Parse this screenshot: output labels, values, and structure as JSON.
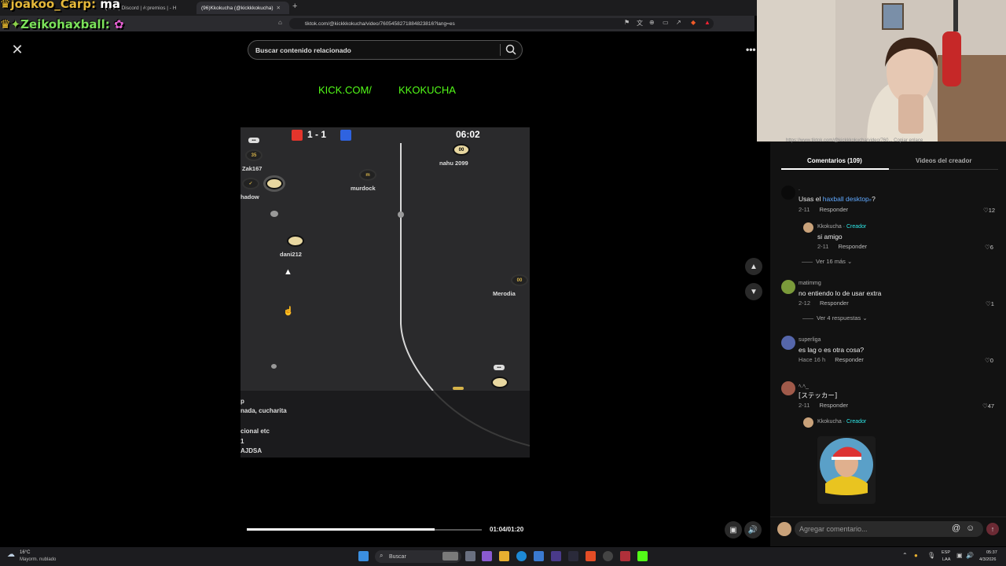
{
  "browser": {
    "tabs": [
      {
        "label": "(4678) Discord | #",
        "active": false
      },
      {
        "label": ":premios | - H",
        "active": false
      },
      {
        "label": "(96)Kkokucha (@kickkkokucha)",
        "active": true
      }
    ],
    "url": "tiktok.com/@kickkkokucha/video/7605458271884823816?lang=es"
  },
  "chat_overlay": {
    "line1_user": "joakoo_Carp:",
    "line1_msg": "ma",
    "line2_user": "Zeikohaxball:"
  },
  "video": {
    "search_placeholder": "Buscar contenido relacionado",
    "banner_left": "KICK.COM/",
    "banner_right": "KKOKUCHA",
    "score": "1 - 1",
    "timer": "06:02",
    "players": [
      {
        "name": "Zak167"
      },
      {
        "name": "hadow"
      },
      {
        "name": "murdock"
      },
      {
        "name": "nahu 2099"
      },
      {
        "name": "dani212"
      },
      {
        "name": "Merodia"
      }
    ],
    "overlay_lines": [
      "p",
      "nada, cucharita",
      "cional etc",
      "1",
      "AJDSA"
    ],
    "progress_time": "01:04/01:20",
    "progress_fraction": 0.8
  },
  "panel": {
    "tabs": {
      "comments": "Comentarios (109)",
      "videos": "Videos del creador"
    },
    "link_text": "https://www.tiktok.com/@kickkkokucha/video/760...   Copiar enlace",
    "comments": [
      {
        "user": ".",
        "text_before": "Usas el ",
        "link": "haxball desktop",
        "text_after": "?",
        "date": "2-11",
        "reply": "Responder",
        "likes": "12"
      },
      {
        "user": "Kkokucha",
        "creator": " · Creador",
        "text": "si amigo",
        "date": "2-11",
        "reply": "Responder",
        "likes": "6"
      },
      {
        "more": "Ver 16 más"
      },
      {
        "user": "matimmg",
        "text": "no entiendo lo de usar extra",
        "date": "2-12",
        "reply": "Responder",
        "likes": "1"
      },
      {
        "more": "Ver 4 respuestas"
      },
      {
        "user": "superliga",
        "text": "es lag o es otra cosa?",
        "date": "Hace 16 h",
        "reply": "Responder",
        "likes": "0"
      },
      {
        "user": "ﾍ.ﾍ_",
        "text": "[ステッカー]",
        "date": "2-11",
        "reply": "Responder",
        "likes": "47"
      },
      {
        "user": "Kkokucha",
        "creator": " · Creador"
      }
    ],
    "comment_placeholder": "Agregar comentario..."
  },
  "taskbar": {
    "weather_temp": "16°C",
    "weather_desc": "Mayorm. nublado",
    "search_label": "Buscar",
    "lang1": "ESP",
    "lang2": "LAA",
    "time": "05:37",
    "date": "4/3/2026"
  }
}
